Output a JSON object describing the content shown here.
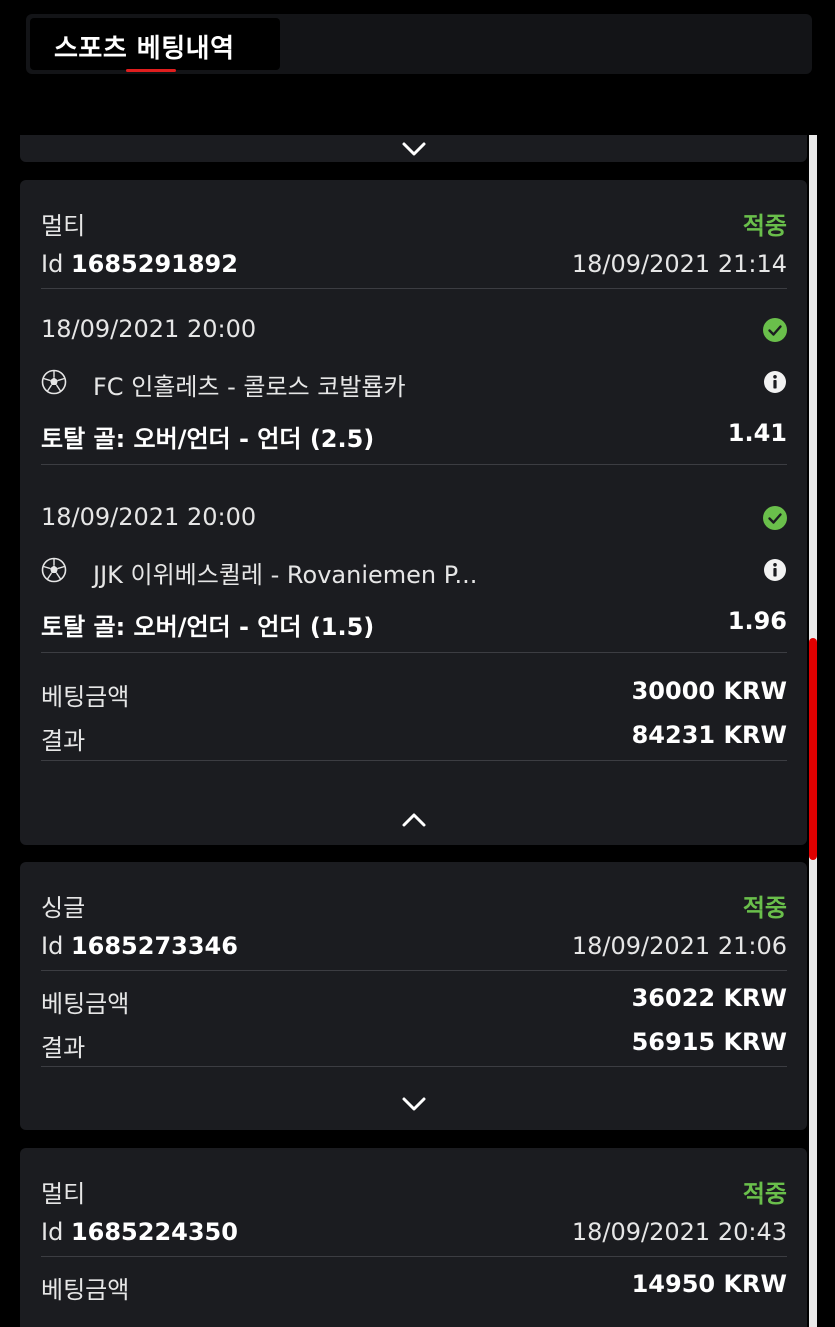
{
  "header": {
    "title": "스포츠 베팅내역"
  },
  "cards": [
    {
      "type": "멀티",
      "status": "적중",
      "id_label": "Id",
      "id": "1685291892",
      "datetime": "18/09/2021 21:14",
      "selections": [
        {
          "date": "18/09/2021 20:00",
          "event": "FC 인홀레츠 - 콜로스 코발룝카",
          "market": "토탈 골: 오버/언더 - 언더 (2.5)",
          "odds": "1.41"
        },
        {
          "date": "18/09/2021 20:00",
          "event": "JJK 이위베스퀼레 - Rovaniemen P...",
          "market": "토탈 골: 오버/언더 - 언더 (1.5)",
          "odds": "1.96"
        }
      ],
      "stake_label": "베팅금액",
      "stake": "30000 KRW",
      "result_label": "결과",
      "result": "84231 KRW"
    },
    {
      "type": "싱글",
      "status": "적중",
      "id_label": "Id",
      "id": "1685273346",
      "datetime": "18/09/2021 21:06",
      "stake_label": "베팅금액",
      "stake": "36022 KRW",
      "result_label": "결과",
      "result": "56915 KRW"
    },
    {
      "type": "멀티",
      "status": "적중",
      "id_label": "Id",
      "id": "1685224350",
      "datetime": "18/09/2021 20:43",
      "stake_label": "베팅금액",
      "stake": "14950 KRW"
    }
  ],
  "colors": {
    "win": "#6abf4b",
    "scroll_thumb": "#e00000",
    "underline": "#e01e1e"
  }
}
